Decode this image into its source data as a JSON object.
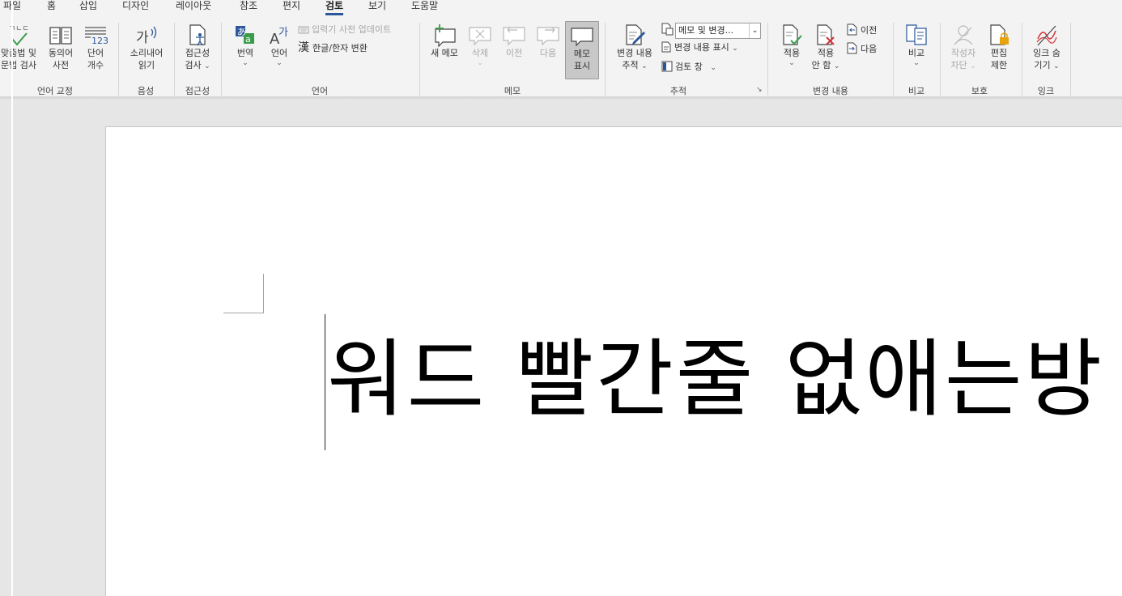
{
  "tabs": [
    "파일",
    "홈",
    "삽입",
    "디자인",
    "레이아웃",
    "참조",
    "편지",
    "검토",
    "보기",
    "도움말"
  ],
  "ribbon": {
    "proofing": {
      "spelling": [
        "맞춤법 및",
        "문법 검사"
      ],
      "thesaurus": [
        "동의어",
        "사전"
      ],
      "wordcount": [
        "단어",
        "개수"
      ],
      "group": "언어 교정"
    },
    "speech": {
      "readaloud": [
        "소리내어",
        "읽기"
      ],
      "group": "음성"
    },
    "accessibility": {
      "check": [
        "접근성",
        "검사"
      ],
      "group": "접근성"
    },
    "language": {
      "translate": "번역",
      "lang": "언어",
      "update_dict": "입력기 사전 업데이트",
      "hanja": "한글/한자 변환",
      "group": "언어"
    },
    "comments": {
      "new": "새 메모",
      "delete": "삭제",
      "prev": "이전",
      "next": "다음",
      "show": [
        "메모",
        "표시"
      ],
      "group": "메모"
    },
    "tracking": {
      "track": [
        "변경 내용",
        "추적"
      ],
      "markup_select": "메모 및 변경...",
      "show_markup": "변경 내용 표시",
      "review_pane": "검토 창",
      "group": "추적"
    },
    "changes": {
      "accept": "적용",
      "reject": [
        "적용",
        "안 함"
      ],
      "prev": "이전",
      "next": "다음",
      "group": "변경 내용"
    },
    "compare": {
      "compare": "비교",
      "group": "비교"
    },
    "protect": {
      "block_authors": [
        "작성자",
        "차단"
      ],
      "restrict": [
        "편집",
        "제한"
      ],
      "group": "보호"
    },
    "ink": {
      "hide": [
        "잉크 숨",
        "기기"
      ],
      "group": "잉크"
    },
    "wordcount_icon_text": "123",
    "abc_icon_text": "ㄱㄴㄷ",
    "ga_icon_text": "가",
    "a_icon_text": "A",
    "hanja_icon_text": "漢"
  },
  "document": {
    "text": "워드 빨간줄 없애는방"
  },
  "colors": {
    "accent": "#2b579a",
    "ribbon_bg": "#f3f3f3",
    "workspace": "#e6e6e6",
    "check_green": "#3a9b4a",
    "reject_red": "#d13438"
  }
}
